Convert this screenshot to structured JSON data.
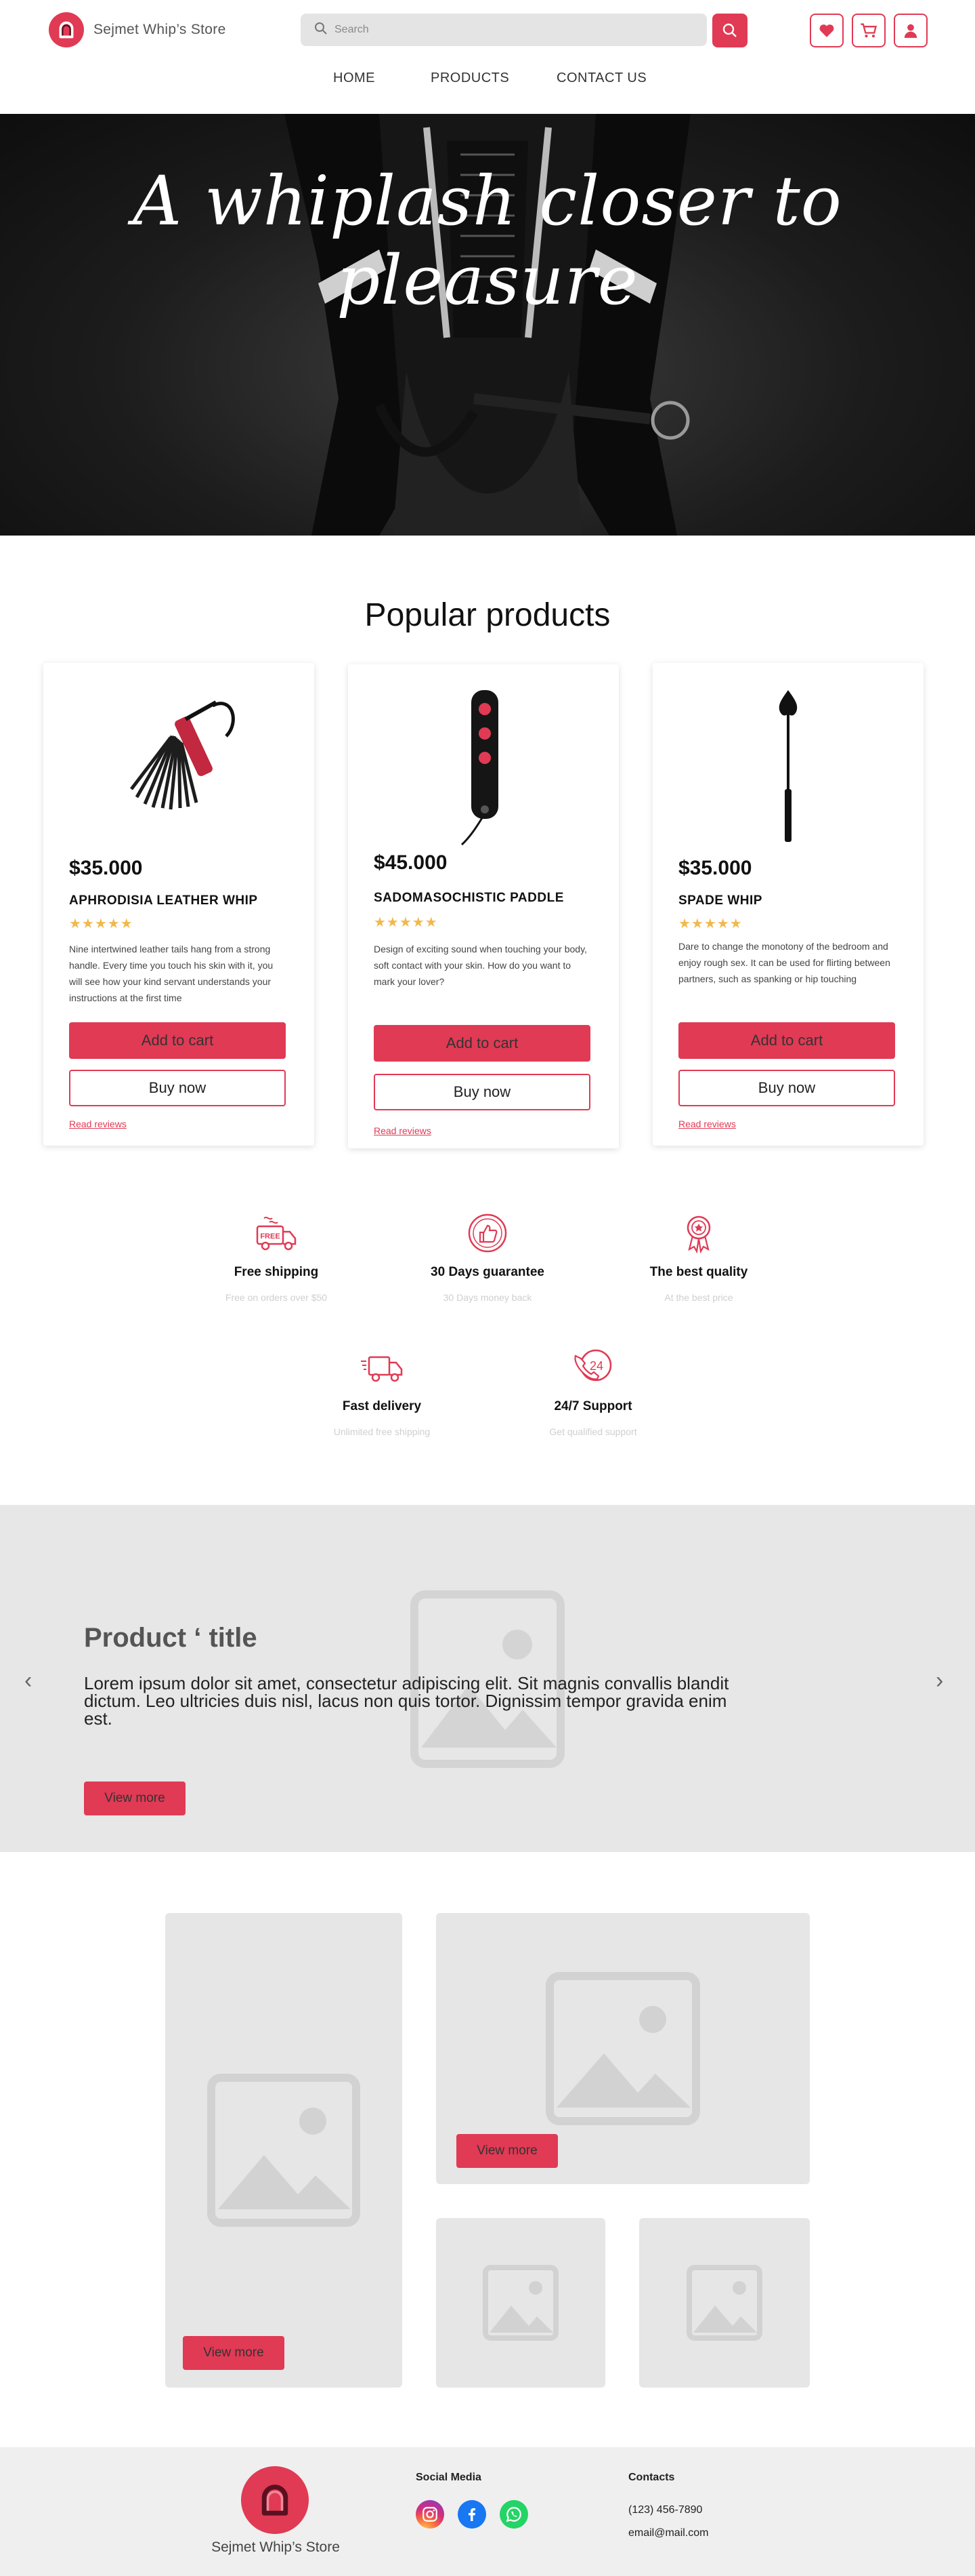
{
  "header": {
    "brand": "Sejmet Whip’s Store",
    "search_placeholder": "Search"
  },
  "nav": [
    "HOME",
    "PRODUCTS",
    "CONTACT US"
  ],
  "hero": {
    "title": "A whiplash closer to pleasure"
  },
  "popular": {
    "title": "Popular products",
    "products": [
      {
        "price": "$35.000",
        "name": "APHRODISIA LEATHER WHIP",
        "stars": "★★★★★",
        "description": "Nine intertwined leather tails hang from a strong handle. Every time you touch his skin with it, you will see how your kind servant understands your instructions at the first time",
        "add_to_cart": "Add to cart",
        "buy_now": "Buy now",
        "reviews": "Read reviews"
      },
      {
        "price": "$45.000",
        "name": "SADOMASOCHISTIC PADDLE",
        "stars": "★★★★★",
        "description": "Design of exciting sound when touching your body, soft contact with your skin. How do you want to mark your lover?",
        "add_to_cart": "Add to cart",
        "buy_now": "Buy now",
        "reviews": "Read reviews"
      },
      {
        "price": "$35.000",
        "name": "SPADE WHIP",
        "stars": "★★★★★",
        "description": "Dare to change the monotony of the bedroom and enjoy rough sex. It can be used for flirting between partners, such as spanking or hip touching",
        "add_to_cart": "Add to cart",
        "buy_now": "Buy now",
        "reviews": "Read reviews"
      }
    ]
  },
  "features": [
    {
      "icon": "free-shipping-truck-icon",
      "title": "Free shipping",
      "subtitle": "Free on orders over $50",
      "badge": "FREE"
    },
    {
      "icon": "thumbs-up-icon",
      "title": "30 Days guarantee",
      "subtitle": "30 Days money back"
    },
    {
      "icon": "quality-medal-icon",
      "title": "The best quality",
      "subtitle": "At the best price"
    },
    {
      "icon": "delivery-truck-icon",
      "title": "Fast delivery",
      "subtitle": "Unlimited free shipping"
    },
    {
      "icon": "support-24-icon",
      "title": "24/7 Support",
      "subtitle": "Get qualified support",
      "badge": "24"
    }
  ],
  "slider": {
    "title": "Product ‘ title",
    "text": "Lorem ipsum dolor sit amet, consectetur adipiscing elit. Sit magnis convallis blandit dictum. Leo ultricies duis nisl, lacus non quis tortor. Dignissim tempor gravida enim est.",
    "button": "View more",
    "prev": "‹",
    "next": "›"
  },
  "gallery": {
    "button": "View more"
  },
  "footer": {
    "brand": "Sejmet Whip’s Store",
    "social_heading": "Social Media",
    "contacts_heading": "Contacts",
    "phone": "(123) 456-7890",
    "email": "email@mail.com"
  },
  "colors": {
    "accent": "#e03a54",
    "star": "#f2b84b",
    "placeholder": "#e6e6e6"
  }
}
